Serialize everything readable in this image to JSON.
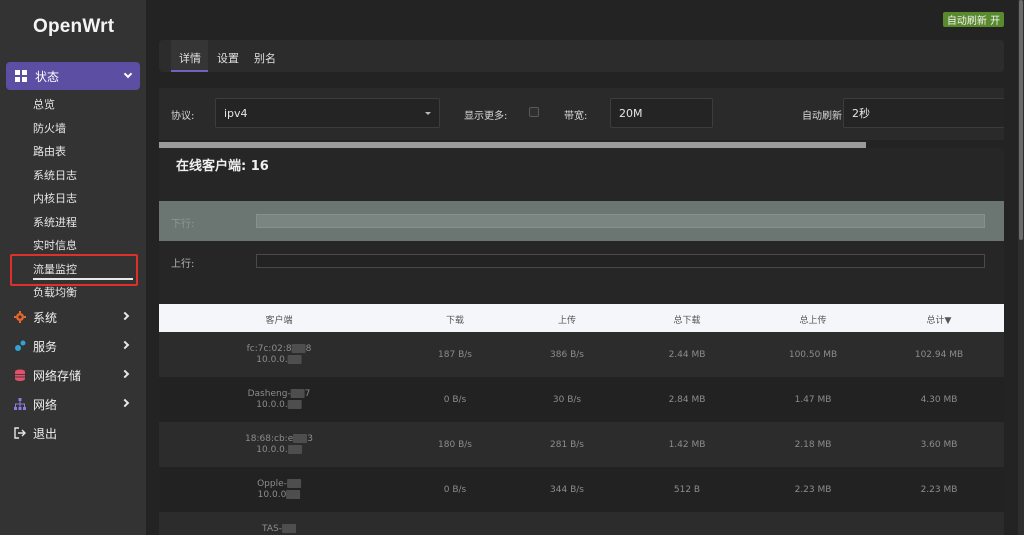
{
  "sidebar": {
    "brand": "OpenWrt",
    "active_menu": "状态",
    "sub_items": [
      "总览",
      "防火墙",
      "路由表",
      "系统日志",
      "内核日志",
      "系统进程",
      "实时信息",
      "流量监控",
      "负载均衡"
    ],
    "menus": [
      {
        "label": "系统",
        "icon": "gear-icon",
        "color": "#e8672d"
      },
      {
        "label": "服务",
        "icon": "services-icon",
        "color": "#2fa3d6"
      },
      {
        "label": "网络存储",
        "icon": "database-icon",
        "color": "#e0526b"
      },
      {
        "label": "网络",
        "icon": "network-icon",
        "color": "#8f7ae0"
      },
      {
        "label": "退出",
        "icon": "logout-icon",
        "color": "#e6e6e6"
      }
    ]
  },
  "header": {
    "auto_refresh_button": "自动刷新 开"
  },
  "tabs": [
    "详情",
    "设置",
    "别名"
  ],
  "filters": {
    "protocol_label": "协议:",
    "protocol_value": "ipv4",
    "show_more_label": "显示更多:",
    "bandwidth_label": "带宽:",
    "bandwidth_value": "20M",
    "refresh_label": "自动刷新",
    "refresh_value": "2秒"
  },
  "clients": {
    "title": "在线客户端: 16",
    "down_label": "下行:",
    "up_label": "上行:",
    "columns": [
      "客户端",
      "下载",
      "上传",
      "总下载",
      "总上传",
      "总计▼"
    ],
    "rows": [
      {
        "name_pre": "fc:7c:02:8",
        "name_post": "8",
        "ip_pre": "10.0.0.",
        "down": "187 B/s",
        "up": "386 B/s",
        "total_down": "2.44 MB",
        "total_up": "100.50 MB",
        "total": "102.94 MB"
      },
      {
        "name_pre": "Dasheng-",
        "name_post": "7",
        "ip_pre": "10.0.0.",
        "down": "0 B/s",
        "up": "30 B/s",
        "total_down": "2.84 MB",
        "total_up": "1.47 MB",
        "total": "4.30 MB"
      },
      {
        "name_pre": "18:68:cb:e",
        "name_post": "3",
        "ip_pre": "10.0.0.",
        "down": "180 B/s",
        "up": "281 B/s",
        "total_down": "1.42 MB",
        "total_up": "2.18 MB",
        "total": "3.60 MB"
      },
      {
        "name_pre": "Opple-",
        "name_post": "",
        "ip_pre": "10.0.0",
        "down": "0 B/s",
        "up": "344 B/s",
        "total_down": "512 B",
        "total_up": "2.23 MB",
        "total": "2.23 MB"
      },
      {
        "name_pre": "TAS-",
        "name_post": "",
        "ip_pre": "",
        "down": "",
        "up": "",
        "total_down": "",
        "total_up": "",
        "total": ""
      }
    ]
  }
}
